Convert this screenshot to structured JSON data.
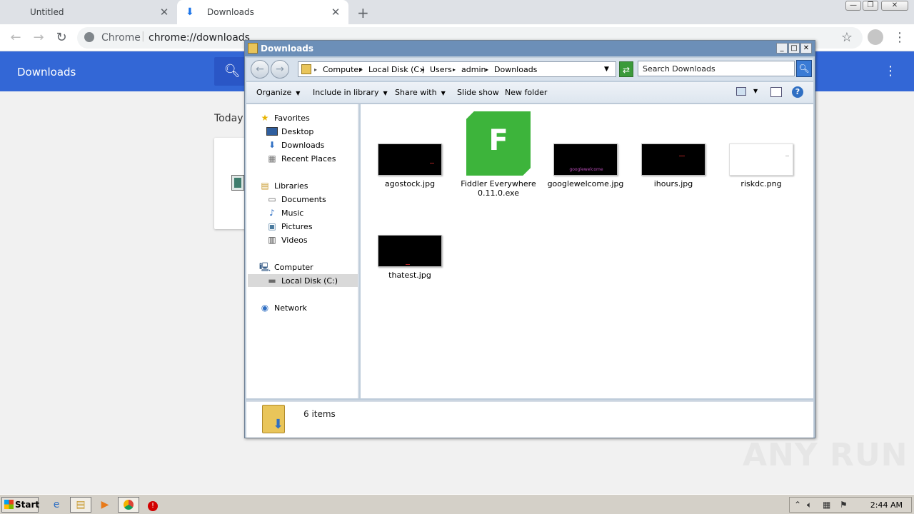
{
  "chrome": {
    "tabs": [
      {
        "label": "Untitled",
        "active": false
      },
      {
        "label": "Downloads",
        "active": true
      }
    ],
    "new_tab_label": "+",
    "omnibox": {
      "scheme_label": "Chrome",
      "url": "chrome://downloads"
    }
  },
  "downloads_page": {
    "title": "Downloads",
    "section_label": "Today"
  },
  "explorer": {
    "title": "Downloads",
    "breadcrumbs": [
      "Computer",
      "Local Disk (C:)",
      "Users",
      "admin",
      "Downloads"
    ],
    "search_placeholder": "Search Downloads",
    "commands": [
      {
        "label": "Organize",
        "dropdown": true
      },
      {
        "label": "Include in library",
        "dropdown": true
      },
      {
        "label": "Share with",
        "dropdown": true
      },
      {
        "label": "Slide show",
        "dropdown": false
      },
      {
        "label": "New folder",
        "dropdown": false
      }
    ],
    "nav": {
      "favorites": {
        "label": "Favorites",
        "items": [
          "Desktop",
          "Downloads",
          "Recent Places"
        ]
      },
      "libraries": {
        "label": "Libraries",
        "items": [
          "Documents",
          "Music",
          "Pictures",
          "Videos"
        ]
      },
      "computer": {
        "label": "Computer",
        "items": [
          "Local Disk (C:)"
        ]
      },
      "network": {
        "label": "Network"
      }
    },
    "files": [
      {
        "name": "agostock.jpg",
        "kind": "dark-image"
      },
      {
        "name": "Fiddler Everywhere 0.11.0.exe",
        "kind": "exe-icon",
        "icon_letter": "F"
      },
      {
        "name": "googlewelcome.jpg",
        "kind": "dark-image",
        "caption": "googlewelcome"
      },
      {
        "name": "ihours.jpg",
        "kind": "dark-image"
      },
      {
        "name": "riskdc.png",
        "kind": "light-image"
      },
      {
        "name": "thatest.jpg",
        "kind": "dark-image"
      }
    ],
    "status": "6 items"
  },
  "watermark": "ANY RUN",
  "taskbar": {
    "start_label": "Start",
    "clock": "2:44 AM"
  },
  "colors": {
    "chrome_blue": "#3367d6",
    "explorer_title": "#6c8fb8",
    "fiddler_green": "#3db43b"
  }
}
